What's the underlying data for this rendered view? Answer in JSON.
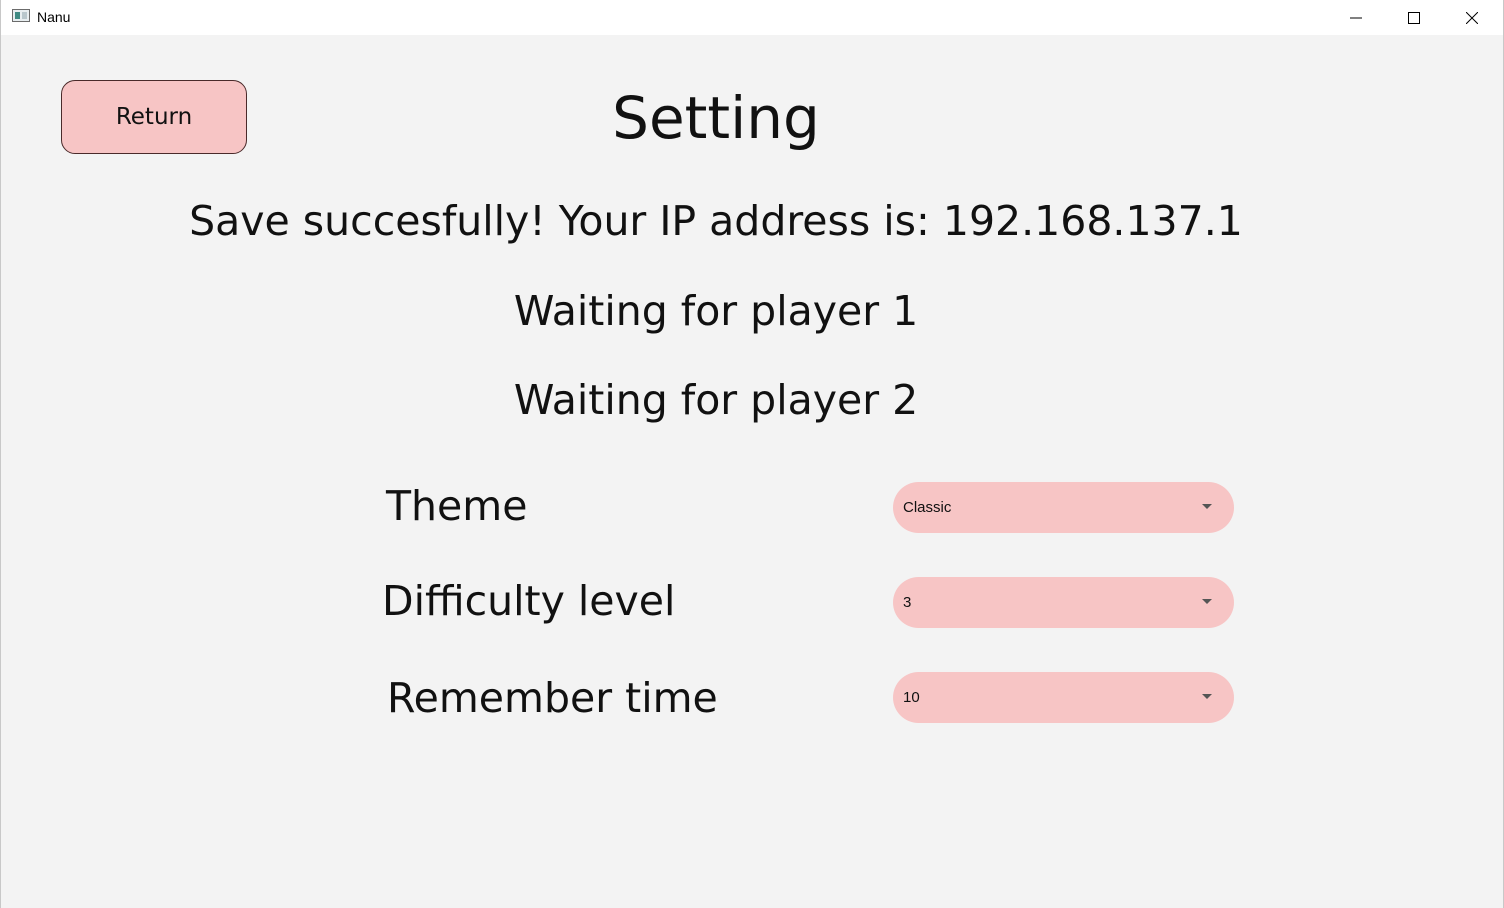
{
  "window": {
    "title": "Nanu"
  },
  "return_button": {
    "label": "Return"
  },
  "page": {
    "title": "Setting",
    "save_message": "Save succesfully! Your IP address is: 192.168.137.1",
    "player1_status": "Waiting for player 1",
    "player2_status": "Waiting for player 2"
  },
  "settings": {
    "theme": {
      "label": "Theme",
      "value": "Classic"
    },
    "difficulty": {
      "label": "Difficulty level",
      "value": "3"
    },
    "remember_time": {
      "label": "Remember time",
      "value": "10"
    }
  },
  "colors": {
    "accent": "#f7c5c5",
    "background": "#f3f3f3"
  }
}
